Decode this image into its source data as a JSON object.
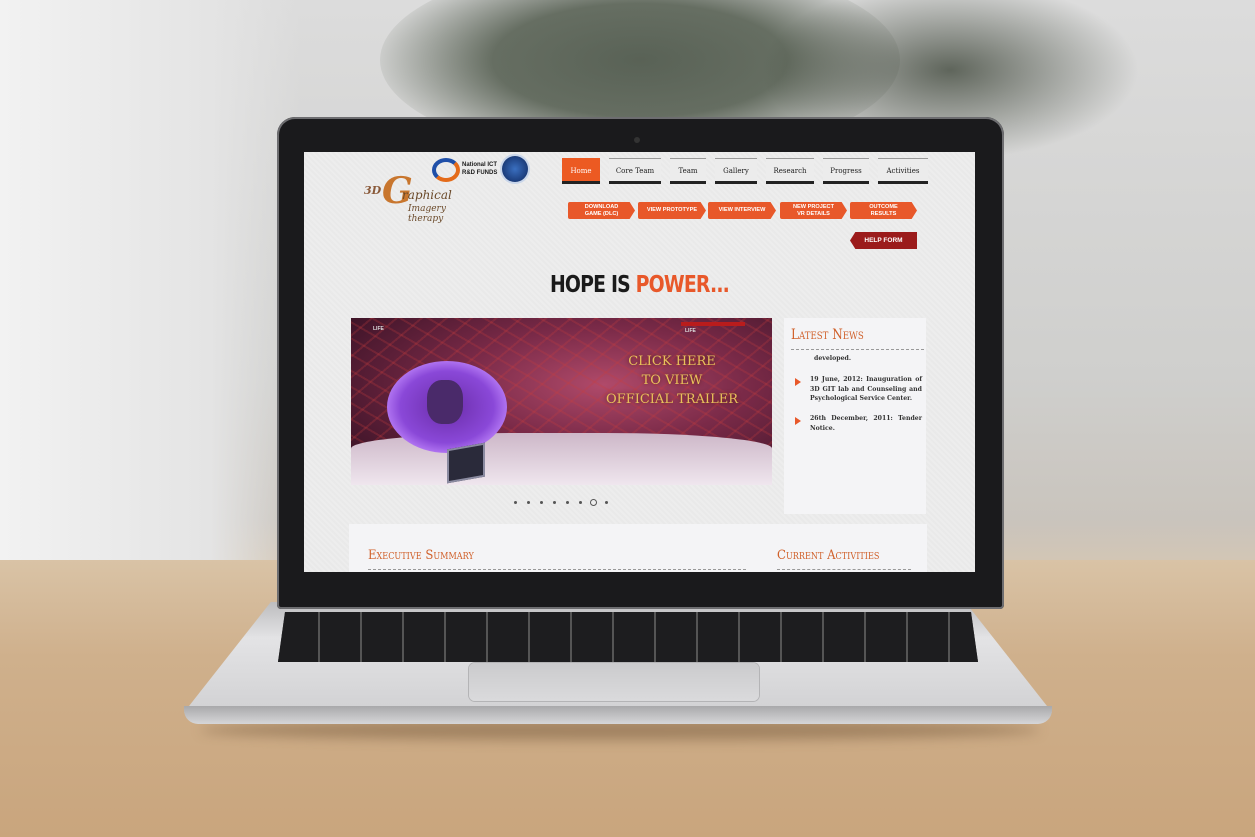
{
  "site": {
    "logo_text_3d": "3D",
    "logo_letter": "G",
    "logo_text_graphical": "raphical",
    "logo_text_sub": "Imagery therapy",
    "ict_logo_text_line1": "National ICT",
    "ict_logo_text_line2": "R&D FUNDS"
  },
  "nav": {
    "items": [
      {
        "label": "Home",
        "active": true
      },
      {
        "label": "Core Team"
      },
      {
        "label": "Team"
      },
      {
        "label": "Gallery"
      },
      {
        "label": "Research"
      },
      {
        "label": "Progress"
      },
      {
        "label": "Activities"
      }
    ]
  },
  "action_buttons": {
    "download": "DOWNLOAD\nGAME (DLC)",
    "prototype": "VIEW PROTOTYPE",
    "interview": "VIEW INTERVIEW",
    "vr": "NEW PROJECT\nVR DETAILS",
    "outcome": "OUTCOME\nRESULTS",
    "help": "HELP FORM"
  },
  "tagline": {
    "part1": "HOPE IS ",
    "part2": "POWER..."
  },
  "slider": {
    "hud_left": "LIFE",
    "hud_right": "LIFE",
    "cta_line1": "CLICK HERE",
    "cta_line2": "TO VIEW",
    "cta_line3": "OFFICIAL TRAILER",
    "slide_count": 8,
    "active_slide": 7
  },
  "latest_news": {
    "title": "Latest News",
    "partial_top": "developed.",
    "items": [
      "19 June, 2012: Inauguration of 3D GIT lab and Counseling and Psychological Service Center.",
      "26th December, 2011: Tender Notice."
    ]
  },
  "sections": {
    "executive_summary": "Executive Summary",
    "current_activities": "Current Activities"
  },
  "colors": {
    "accent": "#e8582a",
    "help": "#9b1b1b",
    "heading": "#d0602a"
  }
}
